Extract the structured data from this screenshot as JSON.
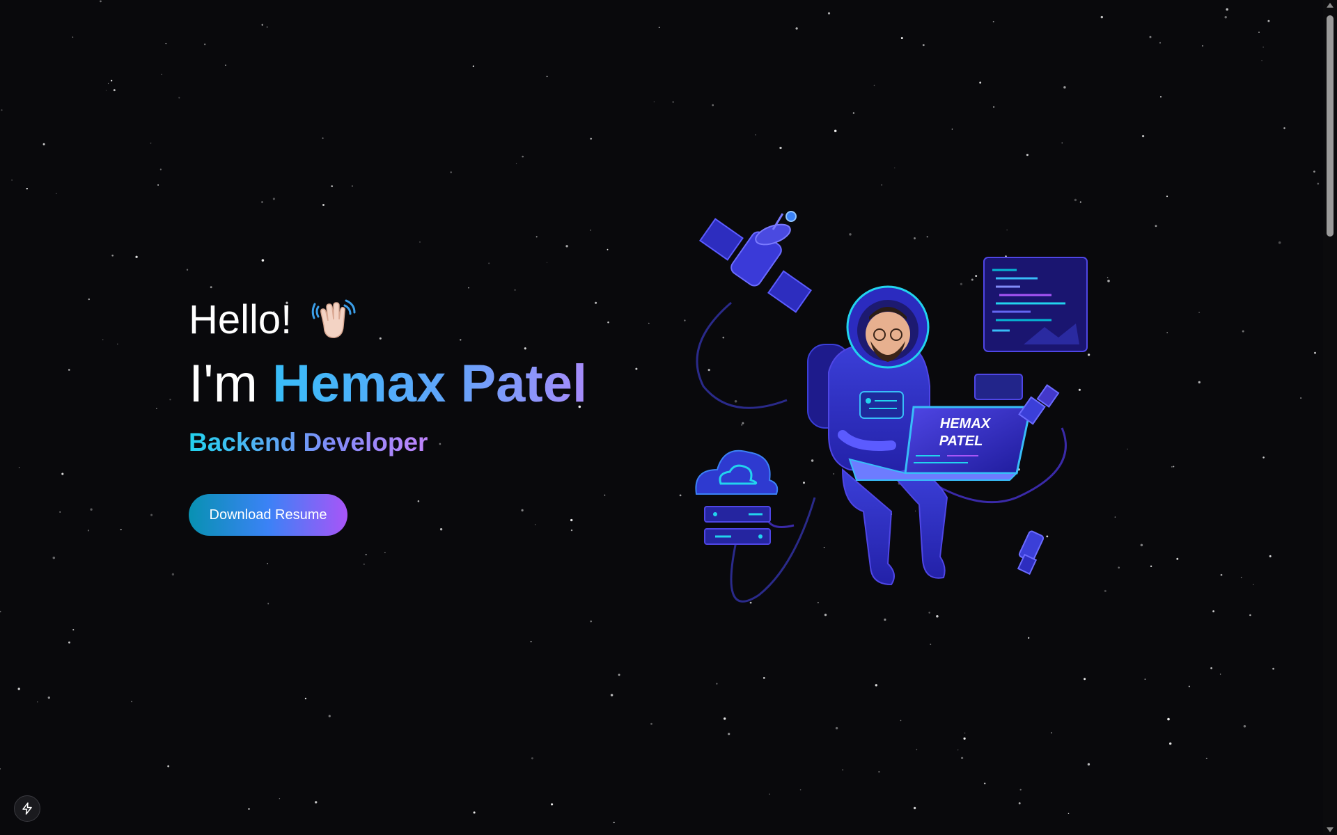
{
  "hero": {
    "greeting": "Hello!",
    "intro": "I'm",
    "name": "Hemax Patel",
    "role": "Backend Developer",
    "cta_label": "Download Resume"
  },
  "illustration": {
    "laptop_line1": "HEMAX",
    "laptop_line2": "PATEL"
  },
  "icons": {
    "wave": "waving-hand-icon",
    "dev_toolbar": "lightning-bolt-icon"
  },
  "colors": {
    "background": "#09090c",
    "name_gradient": [
      "#38bdf8",
      "#60a5fa",
      "#a78bfa"
    ],
    "role_gradient": [
      "#22d3ee",
      "#818cf8",
      "#c084fc"
    ],
    "button_gradient": [
      "#0891b2",
      "#3b82f6",
      "#a855f7"
    ]
  }
}
